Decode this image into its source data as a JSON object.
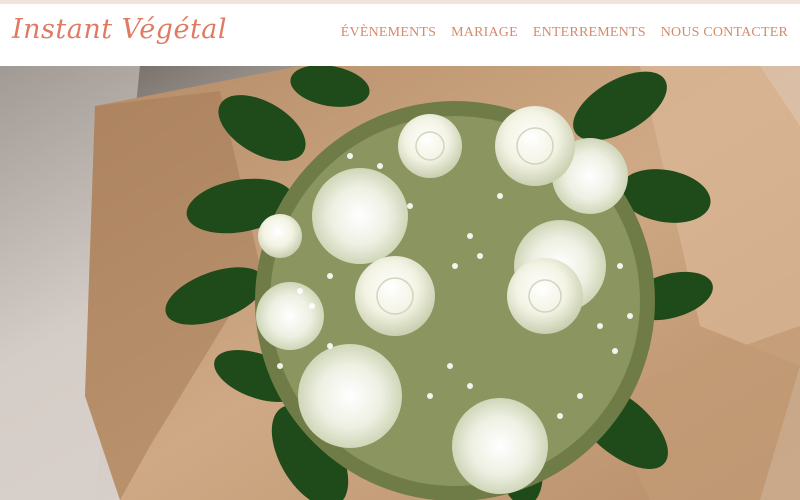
{
  "header": {
    "logo_text": "Instant Végétal",
    "nav": [
      {
        "label": "ÉVÈNEMENTS"
      },
      {
        "label": "MARIAGE"
      },
      {
        "label": "ENTERREMENTS"
      },
      {
        "label": "NOUS CONTACTER"
      }
    ]
  },
  "hero": {
    "image_subject": "white-rose-bouquet-photo"
  },
  "colors": {
    "brand": "#e07a63",
    "nav_text": "#d68a6a",
    "kraft_paper": "#c9a27d",
    "leaves": "#1f4a1a"
  }
}
